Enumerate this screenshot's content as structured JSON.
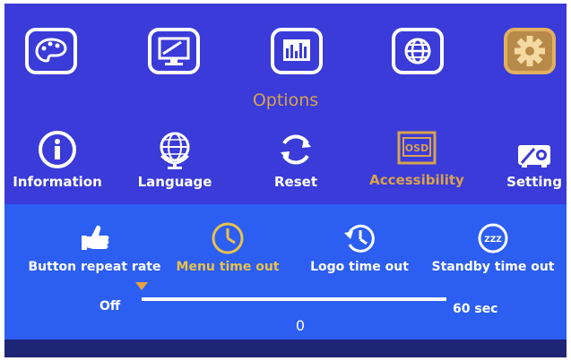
{
  "osd": {
    "categories": [
      {
        "icon": "palette-icon"
      },
      {
        "icon": "monitor-adjust-icon"
      },
      {
        "icon": "equalizer-icon"
      },
      {
        "icon": "globe-icon"
      },
      {
        "icon": "gear-icon"
      }
    ],
    "section_title": "Options",
    "submenu": [
      {
        "label": "Information",
        "icon": "info-icon"
      },
      {
        "label": "Language",
        "icon": "world-icon"
      },
      {
        "label": "Reset",
        "icon": "reset-icon"
      },
      {
        "label": "Accessibility",
        "icon": "osd-icon",
        "icon_text": "OSD"
      },
      {
        "label": "Setting",
        "icon": "projector-setting-icon"
      }
    ],
    "options": [
      {
        "label": "Button repeat rate",
        "icon": "thumbs-up-icon"
      },
      {
        "label": "Menu time out",
        "icon": "clock-icon"
      },
      {
        "label": "Logo time out",
        "icon": "history-icon"
      },
      {
        "label": "Standby time out",
        "icon": "standby-icon",
        "icon_text": "ZZZ"
      }
    ],
    "slider": {
      "min_label": "Off",
      "max_label": "60 sec",
      "value": "0",
      "value_fraction": 0
    },
    "colors": {
      "background": "#3a3bd8",
      "panel": "#2c5ef2",
      "highlight": "#d9a24e",
      "accent": "#e8c24a"
    }
  }
}
